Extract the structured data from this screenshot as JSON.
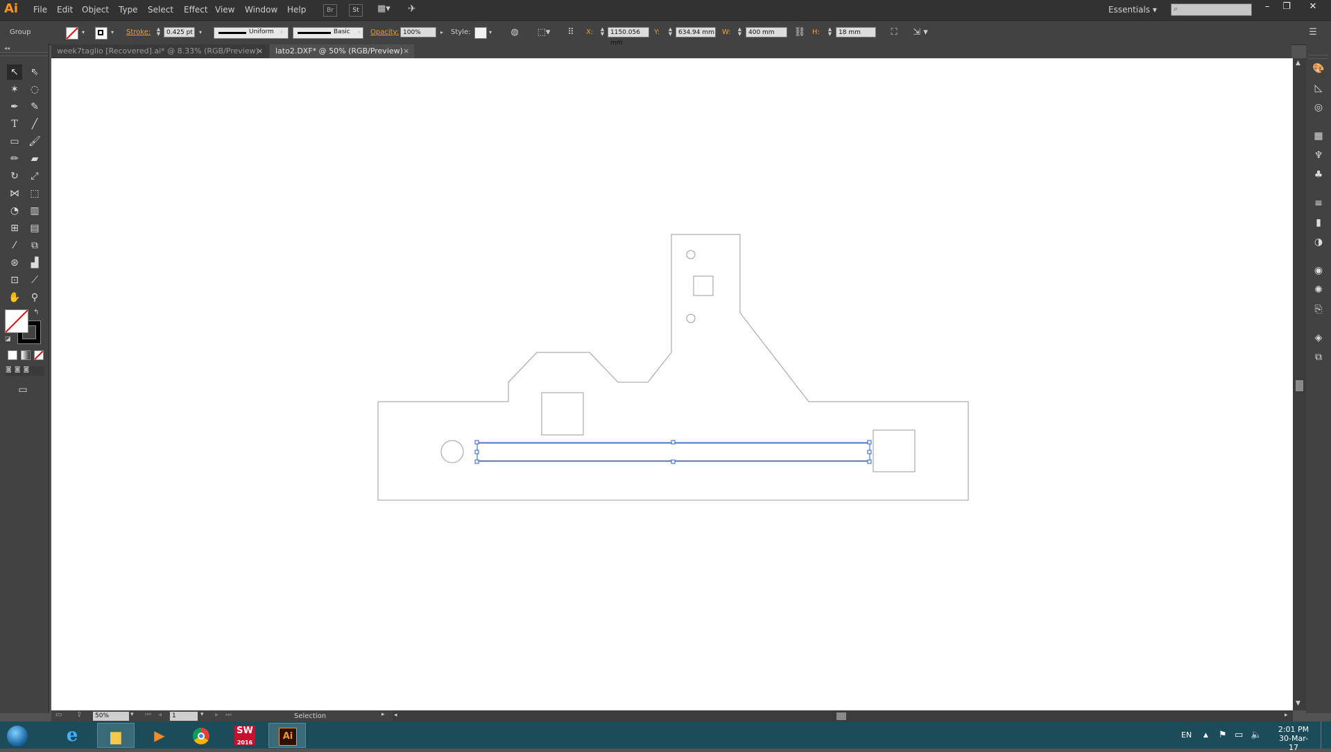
{
  "app": {
    "logo": "Ai"
  },
  "menu": [
    "File",
    "Edit",
    "Object",
    "Type",
    "Select",
    "Effect",
    "View",
    "Window",
    "Help"
  ],
  "menubar_icons": {
    "br": "Br",
    "st": "St"
  },
  "workspace": "Essentials",
  "control_bar": {
    "selection_type": "Group",
    "stroke_label": "Stroke:",
    "stroke_weight": "0.425 pt",
    "profile": "Uniform",
    "brush": "Basic",
    "opacity_label": "Opacity:",
    "opacity": "100%",
    "style_label": "Style:",
    "x_label": "X:",
    "x_value": "1150.056 mm",
    "y_label": "Y:",
    "y_value": "634.94 mm",
    "w_label": "W:",
    "w_value": "400 mm",
    "h_label": "H:",
    "h_value": "18 mm"
  },
  "tabs": [
    {
      "label": "week7taglio [Recovered].ai* @ 8.33% (RGB/Preview)",
      "active": false
    },
    {
      "label": "lato2.DXF* @ 50% (RGB/Preview)",
      "active": true
    }
  ],
  "status_bar": {
    "zoom": "50%",
    "artboard": "1",
    "tool": "Selection"
  },
  "taskbar": {
    "apps": [
      "start",
      "internet-explorer",
      "file-explorer",
      "media-player",
      "chrome",
      "solidworks-2016",
      "illustrator"
    ],
    "solidworks_label": "SW",
    "solidworks_year": "2016",
    "illustrator_label": "Ai",
    "lang": "EN",
    "time": "2:01 PM",
    "date": "30-Mar-17"
  },
  "colors": {
    "accent_orange": "#f0a030",
    "selection_blue": "#1c5fd8",
    "taskbar": "#1c4c5a"
  }
}
